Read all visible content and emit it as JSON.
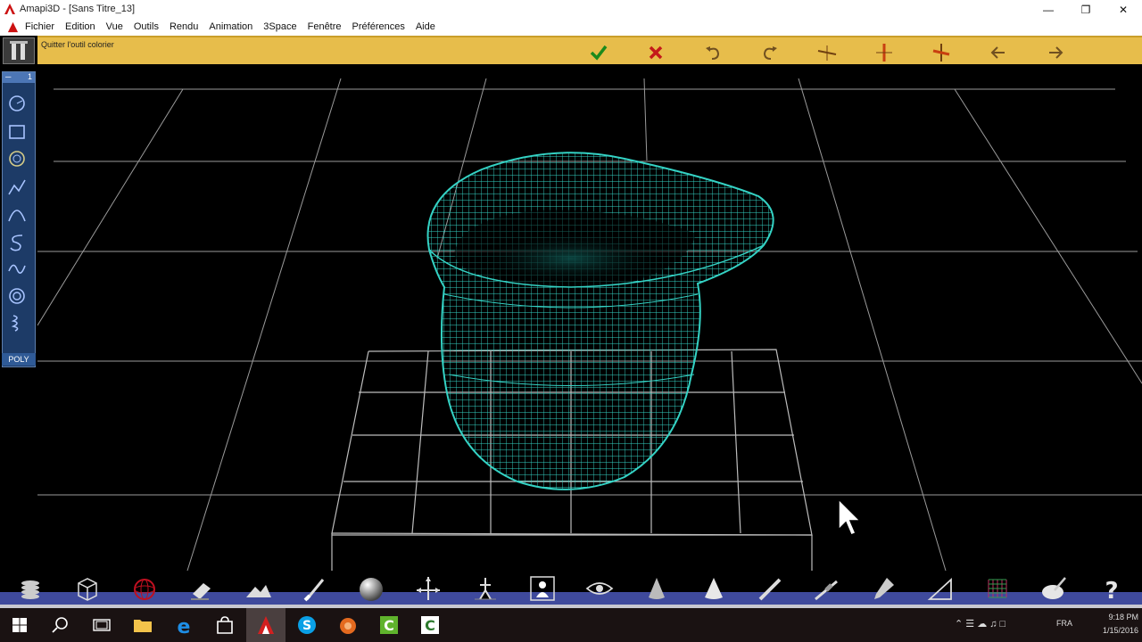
{
  "window": {
    "title": "Amapi3D - [Sans Titre_13]",
    "controls": [
      "minimize-icon",
      "restore-icon",
      "close-icon"
    ]
  },
  "menu": {
    "items": [
      "Fichier",
      "Edition",
      "Vue",
      "Outils",
      "Rendu",
      "Animation",
      "3Space",
      "Fenêtre",
      "Préférences",
      "Aide"
    ]
  },
  "topbar": {
    "hint": "Quitter l'outil colorier",
    "icons": [
      "validate-check-icon",
      "cancel-x-icon",
      "undo-icon",
      "redo-icon",
      "axis-x-icon",
      "axis-y-icon",
      "axis-z-icon",
      "previous-arrow-icon",
      "next-arrow-icon"
    ]
  },
  "leftbar": {
    "badge": "1",
    "mode_label": "POLY",
    "tools": [
      "circle-tool-icon",
      "rectangle-tool-icon",
      "circle-arc-tool-icon",
      "polyline-tool-icon",
      "bezier-curve-tool-icon",
      "spiral-s-tool-icon",
      "spline-tool-icon",
      "spiral-tool-icon",
      "helix-tool-icon"
    ]
  },
  "bottombar": {
    "icons": [
      "layers-icon",
      "cube-icon",
      "sphere-red-icon",
      "eraser-icon",
      "terrain-icon",
      "brush-icon",
      "sphere-chrome-icon",
      "axis-move-icon",
      "figure-icon",
      "presenter-icon",
      "eye-icon",
      "cone-icon",
      "cone-light-icon",
      "pencil-icon",
      "scalpel-icon",
      "dropper-icon",
      "ruler-icon",
      "grid-icon",
      "palette-icon",
      "help-icon"
    ]
  },
  "taskbar": {
    "apps": [
      "windows-start-icon",
      "search-icon",
      "task-view-icon",
      "file-explorer-icon",
      "edge-icon",
      "store-icon",
      "amapi-icon",
      "skype-icon",
      "media-icon",
      "green-app-icon",
      "white-app-icon"
    ],
    "language": "FRA",
    "time": "9:18 PM",
    "date": "1/15/2016"
  },
  "colors": {
    "mesh": "#34d2c4",
    "topbar": "#e7bd4b",
    "bottombar": "#3f4a9c"
  }
}
